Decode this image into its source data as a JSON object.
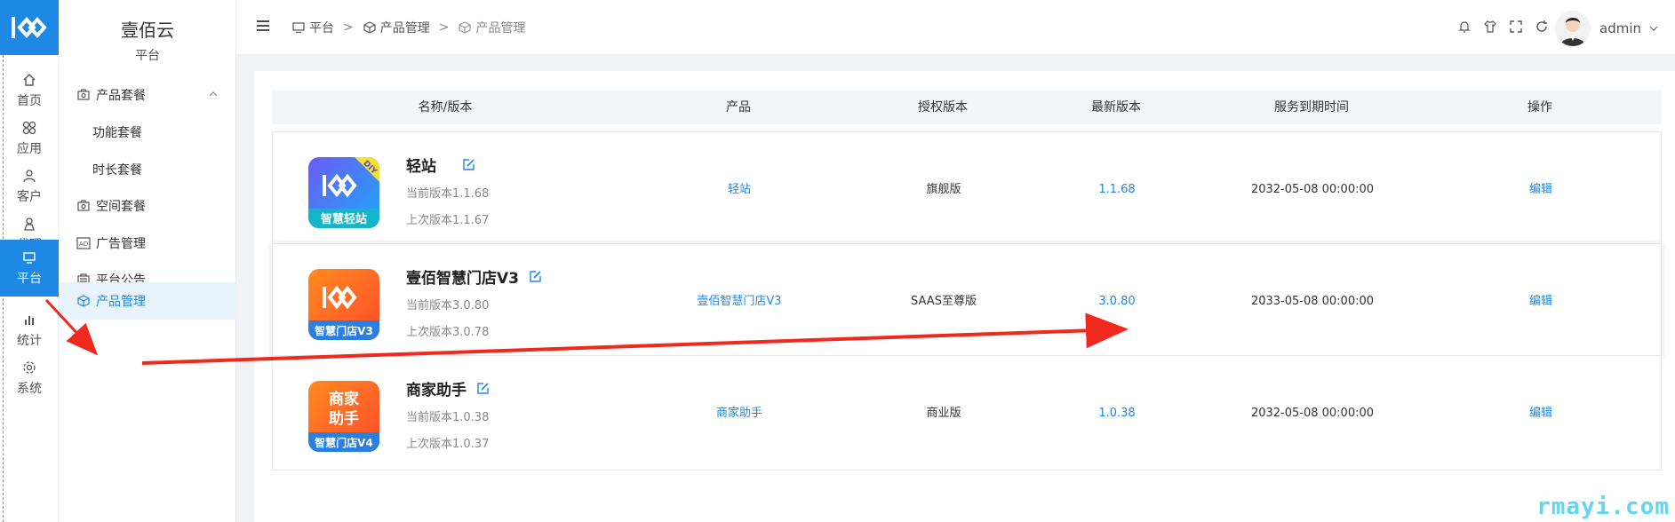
{
  "rail": {
    "items": [
      {
        "label": "首页",
        "icon": "home-icon"
      },
      {
        "label": "应用",
        "icon": "apps-icon"
      },
      {
        "label": "客户",
        "icon": "user-icon"
      },
      {
        "label": "代理",
        "icon": "agent-icon"
      },
      {
        "label": "平台",
        "icon": "monitor-icon"
      },
      {
        "label": "统计",
        "icon": "bar-chart-icon"
      },
      {
        "label": "系统",
        "icon": "gear-icon"
      }
    ],
    "active_index": 4,
    "accent": "#1e88e5"
  },
  "submenu": {
    "title": "壹佰云",
    "subtitle": "平台",
    "items": [
      {
        "label": "产品套餐",
        "icon": "camera-icon"
      },
      {
        "label": "功能套餐"
      },
      {
        "label": "时长套餐"
      },
      {
        "label": "空间套餐",
        "icon": "camera-icon"
      },
      {
        "label": "广告管理",
        "icon": "ad-icon"
      },
      {
        "label": "平台公告",
        "icon": "notice-icon"
      },
      {
        "label": "产品管理",
        "icon": "cube-icon"
      }
    ]
  },
  "breadcrumb": {
    "items": [
      {
        "label": "平台",
        "icon": "monitor-icon"
      },
      {
        "label": "产品管理",
        "icon": "cube-icon"
      },
      {
        "label": "产品管理",
        "icon": "cube-icon"
      }
    ],
    "separator": ">"
  },
  "header": {
    "user": "admin",
    "tools": [
      "bell-icon",
      "shirt-icon",
      "fullscreen-icon",
      "refresh-icon"
    ]
  },
  "table": {
    "columns": [
      "名称/版本",
      "产品",
      "授权版本",
      "最新版本",
      "服务到期时间",
      "操作"
    ],
    "rows": [
      {
        "name": "轻站",
        "current": "当前版本1.1.68",
        "previous": "上次版本1.1.67",
        "product": "轻站",
        "license": "旗舰版",
        "latest": "1.1.68",
        "expire": "2032-05-08 00:00:00",
        "action": "编辑",
        "logo_text": "智慧轻站",
        "logo_badge": "DIY"
      },
      {
        "name": "壹佰智慧门店V3",
        "current": "当前版本3.0.80",
        "previous": "上次版本3.0.78",
        "product": "壹佰智慧门店V3",
        "license": "SAAS至尊版",
        "latest": "3.0.80",
        "expire": "2033-05-08 00:00:00",
        "action": "编辑",
        "logo_text": "智慧门店V3"
      },
      {
        "name": "商家助手",
        "current": "当前版本1.0.38",
        "previous": "上次版本1.0.37",
        "product": "商家助手",
        "license": "商业版",
        "latest": "1.0.38",
        "expire": "2032-05-08 00:00:00",
        "action": "编辑",
        "logo_text": "智慧门店V4",
        "logo_title_line1": "商家",
        "logo_title_line2": "助手"
      }
    ]
  },
  "watermark": "rmayi.com"
}
